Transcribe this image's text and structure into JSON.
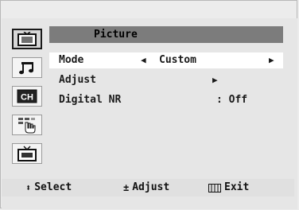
{
  "menu": {
    "title": "Picture",
    "rows": [
      {
        "label": "Mode",
        "value": "Custom"
      },
      {
        "label": "Adjust"
      },
      {
        "label": "Digital NR",
        "value": ": Off"
      }
    ]
  },
  "sidebar": {
    "items": [
      {
        "icon": "tv-picture-icon",
        "active": true
      },
      {
        "icon": "music-note-icon",
        "active": false
      },
      {
        "icon": "channel-icon",
        "label": "CH",
        "active": false
      },
      {
        "icon": "setup-hand-icon",
        "active": false
      },
      {
        "icon": "tv-input-icon",
        "active": false
      }
    ]
  },
  "footer": {
    "select_label": "Select",
    "adjust_label": "Adjust",
    "exit_label": "Exit"
  }
}
